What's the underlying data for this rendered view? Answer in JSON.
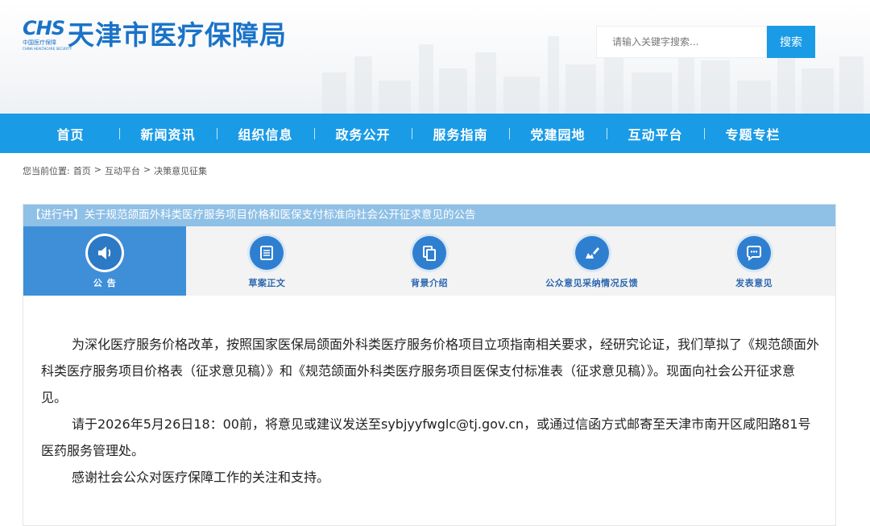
{
  "site": {
    "logo_mark": "CHS",
    "logo_cn": "中国医疗保障",
    "logo_en": "CHINA HEALTHCARE SECURITY",
    "title": "天津市医疗保障局"
  },
  "search": {
    "placeholder": "请输入关键字搜索...",
    "button": "搜索"
  },
  "nav": {
    "items": [
      "首页",
      "新闻资讯",
      "组织信息",
      "政务公开",
      "服务指南",
      "党建园地",
      "互动平台",
      "专题专栏"
    ]
  },
  "breadcrumb": {
    "prefix": "您当前位置:",
    "items": [
      "首页",
      "互动平台",
      "决策意见征集"
    ],
    "separator": ">"
  },
  "notice": {
    "title": "【进行中】关于规范颌面外科类医疗服务项目价格和医保支付标准向社会公开征求意见的公告",
    "tabs": [
      {
        "label": "公告",
        "icon": "speaker-icon",
        "active": true
      },
      {
        "label": "草案正文",
        "icon": "document-icon",
        "active": false
      },
      {
        "label": "背景介绍",
        "icon": "copy-icon",
        "active": false
      },
      {
        "label": "公众意见采纳情况反馈",
        "icon": "edit-pen-icon",
        "active": false
      },
      {
        "label": "发表意见",
        "icon": "chat-bubble-icon",
        "active": false
      }
    ],
    "paragraphs": [
      "为深化医疗服务价格改革，按照国家医保局颌面外科类医疗服务价格项目立项指南相关要求，经研究论证，我们草拟了《规范颌面外科类医疗服务项目价格表（征求意见稿）》和《规范颌面外科类医疗服务项目医保支付标准表（征求意见稿）》。现面向社会公开征求意见。",
      "请于2026年5月26日18：00前，将意见或建议发送至sybjyyfwglc@tj.gov.cn，或通过信函方式邮寄至天津市南开区咸阳路81号医药服务管理处。",
      "感谢社会公众对医疗保障工作的关注和支持。"
    ]
  },
  "colors": {
    "brand": "#1a73c8",
    "nav_bg": "#1a9be6",
    "title_bar": "#8fc0e6",
    "active_tab": "#3e8fd8"
  }
}
